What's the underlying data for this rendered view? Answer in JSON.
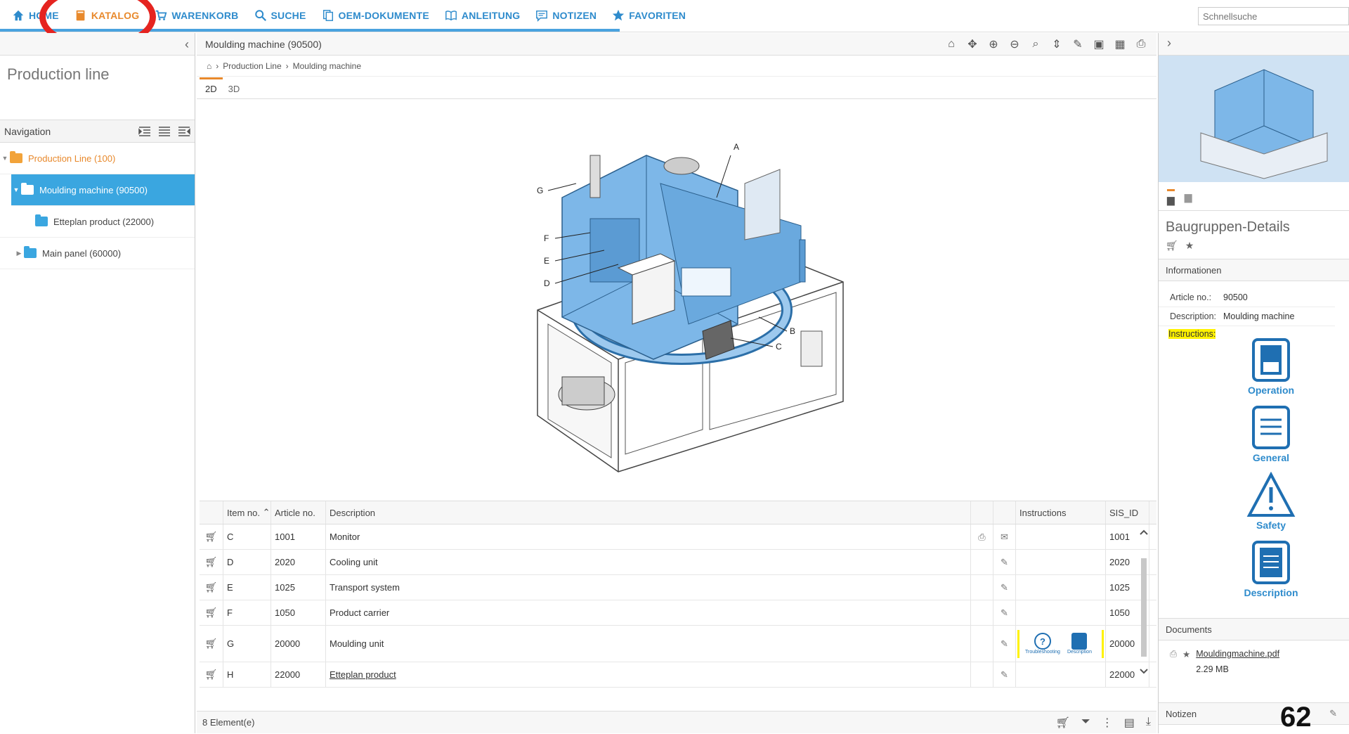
{
  "topnav": {
    "items": [
      {
        "label": "HOME",
        "icon": "home-icon"
      },
      {
        "label": "KATALOG",
        "icon": "book-icon"
      },
      {
        "label": "WARENKORB",
        "icon": "cart-icon"
      },
      {
        "label": "SUCHE",
        "icon": "search-icon"
      },
      {
        "label": "OEM-DOKUMENTE",
        "icon": "documents-icon"
      },
      {
        "label": "ANLEITUNG",
        "icon": "open-book-icon"
      },
      {
        "label": "NOTIZEN",
        "icon": "comment-icon"
      },
      {
        "label": "FAVORITEN",
        "icon": "star-icon"
      }
    ],
    "search_placeholder": "Schnellsuche",
    "colors": {
      "accent": "#4aa3df",
      "active": "#e8892c",
      "annotation": "#e52420"
    }
  },
  "left": {
    "title": "Production line",
    "nav_label": "Navigation",
    "tree": [
      {
        "label": "Production Line (100)"
      },
      {
        "label": "Moulding machine (90500)"
      },
      {
        "label": "Etteplan product (22000)"
      },
      {
        "label": "Main panel (60000)"
      }
    ]
  },
  "center": {
    "title": "Moulding machine (90500)",
    "breadcrumb": [
      "Production Line",
      "Moulding machine"
    ],
    "tabs": [
      "2D",
      "3D"
    ],
    "callouts": [
      "A",
      "B",
      "C",
      "D",
      "E",
      "F",
      "G"
    ],
    "table": {
      "headers": [
        "Item no.",
        "Article no.",
        "Description",
        "Instructions",
        "SIS_ID"
      ],
      "rows": [
        {
          "item": "C",
          "article": "1001",
          "description": "Monitor",
          "sis": "1001"
        },
        {
          "item": "D",
          "article": "2020",
          "description": "Cooling unit",
          "sis": "2020"
        },
        {
          "item": "E",
          "article": "1025",
          "description": "Transport system",
          "sis": "1025"
        },
        {
          "item": "F",
          "article": "1050",
          "description": "Product carrier",
          "sis": "1050"
        },
        {
          "item": "G",
          "article": "20000",
          "description": "Moulding unit",
          "sis": "20000",
          "instr1": "Troubleshooting",
          "instr2": "Description"
        },
        {
          "item": "H",
          "article": "22000",
          "description": "Etteplan product",
          "sis": "22000"
        }
      ]
    },
    "footer": "8 Element(e)"
  },
  "right": {
    "title": "Baugruppen-Details",
    "info_section": "Informationen",
    "article_label": "Article no.:",
    "article_value": "90500",
    "desc_label": "Description:",
    "desc_value": "Moulding machine",
    "instructions_label": "Instructions:",
    "instructions": [
      "Operation",
      "General",
      "Safety",
      "Description"
    ],
    "documents_section": "Documents",
    "doc_name": "Mouldingmachine.pdf",
    "doc_size": "2.29 MB",
    "notes_section": "Notizen"
  },
  "page_number": "62"
}
